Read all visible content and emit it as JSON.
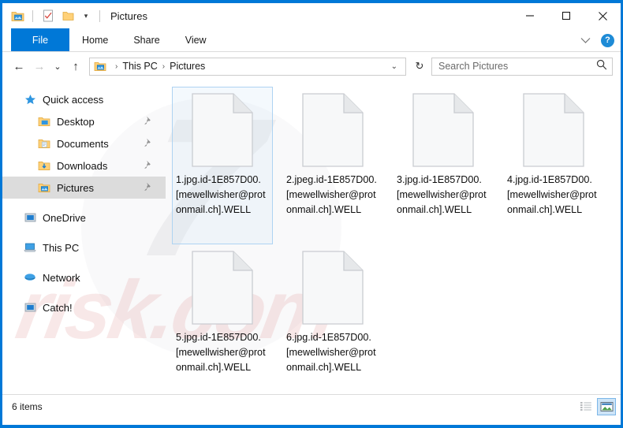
{
  "window": {
    "title": "Pictures",
    "accent_color": "#0078d7",
    "selection_border": "#aed3f2"
  },
  "quick_access_toolbar": {
    "items": [
      {
        "name": "pictures-folder-icon",
        "label": "Pictures folder"
      },
      {
        "name": "properties-icon",
        "label": "Properties"
      },
      {
        "name": "new-folder-icon",
        "label": "New folder"
      },
      {
        "name": "customize-caret-icon",
        "label": "Customize Quick Access Toolbar",
        "glyph": "▾"
      }
    ]
  },
  "window_controls": {
    "minimize": "Minimize",
    "maximize": "Maximize",
    "close": "Close"
  },
  "ribbon": {
    "tabs": [
      {
        "label": "File",
        "active": true
      },
      {
        "label": "Home",
        "active": false
      },
      {
        "label": "Share",
        "active": false
      },
      {
        "label": "View",
        "active": false
      }
    ],
    "expand_label": "⌄",
    "help_label": "?"
  },
  "address_bar": {
    "back": "←",
    "forward": "→",
    "recent": "⌄",
    "up": "↑",
    "breadcrumb": [
      "This PC",
      "Pictures"
    ],
    "breadcrumb_separator": "›",
    "dropdown": "⌄",
    "refresh": "↻"
  },
  "search": {
    "placeholder": "Search Pictures",
    "value": "",
    "icon": "search-icon"
  },
  "sidebar": {
    "groups": [
      {
        "items": [
          {
            "label": "Quick access",
            "icon": "star-icon",
            "child": false,
            "pinned": false,
            "selected": false
          },
          {
            "label": "Desktop",
            "icon": "desktop-folder-icon",
            "child": true,
            "pinned": true,
            "selected": false
          },
          {
            "label": "Documents",
            "icon": "documents-folder-icon",
            "child": true,
            "pinned": true,
            "selected": false
          },
          {
            "label": "Downloads",
            "icon": "downloads-folder-icon",
            "child": true,
            "pinned": true,
            "selected": false
          },
          {
            "label": "Pictures",
            "icon": "pictures-folder-icon",
            "child": true,
            "pinned": true,
            "selected": true
          }
        ]
      },
      {
        "items": [
          {
            "label": "OneDrive",
            "icon": "onedrive-icon",
            "child": false,
            "pinned": false,
            "selected": false
          }
        ]
      },
      {
        "items": [
          {
            "label": "This PC",
            "icon": "this-pc-icon",
            "child": false,
            "pinned": false,
            "selected": false
          }
        ]
      },
      {
        "items": [
          {
            "label": "Network",
            "icon": "network-icon",
            "child": false,
            "pinned": false,
            "selected": false
          }
        ]
      },
      {
        "items": [
          {
            "label": "Catch!",
            "icon": "catch-drive-icon",
            "child": false,
            "pinned": false,
            "selected": false
          }
        ]
      }
    ]
  },
  "files": [
    {
      "name": "1.jpg.id-1E857D00.[mewellwisher@protonmail.ch].WELL",
      "icon": "blank-document-icon",
      "selected": true
    },
    {
      "name": "2.jpeg.id-1E857D00.[mewellwisher@protonmail.ch].WELL",
      "icon": "blank-document-icon",
      "selected": false
    },
    {
      "name": "3.jpg.id-1E857D00.[mewellwisher@protonmail.ch].WELL",
      "icon": "blank-document-icon",
      "selected": false
    },
    {
      "name": "4.jpg.id-1E857D00.[mewellwisher@protonmail.ch].WELL",
      "icon": "blank-document-icon",
      "selected": false
    },
    {
      "name": "5.jpg.id-1E857D00.[mewellwisher@protonmail.ch].WELL",
      "icon": "blank-document-icon",
      "selected": false
    },
    {
      "name": "6.jpg.id-1E857D00.[mewellwisher@protonmail.ch].WELL",
      "icon": "blank-document-icon",
      "selected": false
    }
  ],
  "status_bar": {
    "item_count": "6 items",
    "views": [
      {
        "name": "details-view",
        "active": false
      },
      {
        "name": "large-icons-view",
        "active": true
      }
    ]
  },
  "watermarks": {
    "big": "7",
    "risk": "risk.com"
  }
}
